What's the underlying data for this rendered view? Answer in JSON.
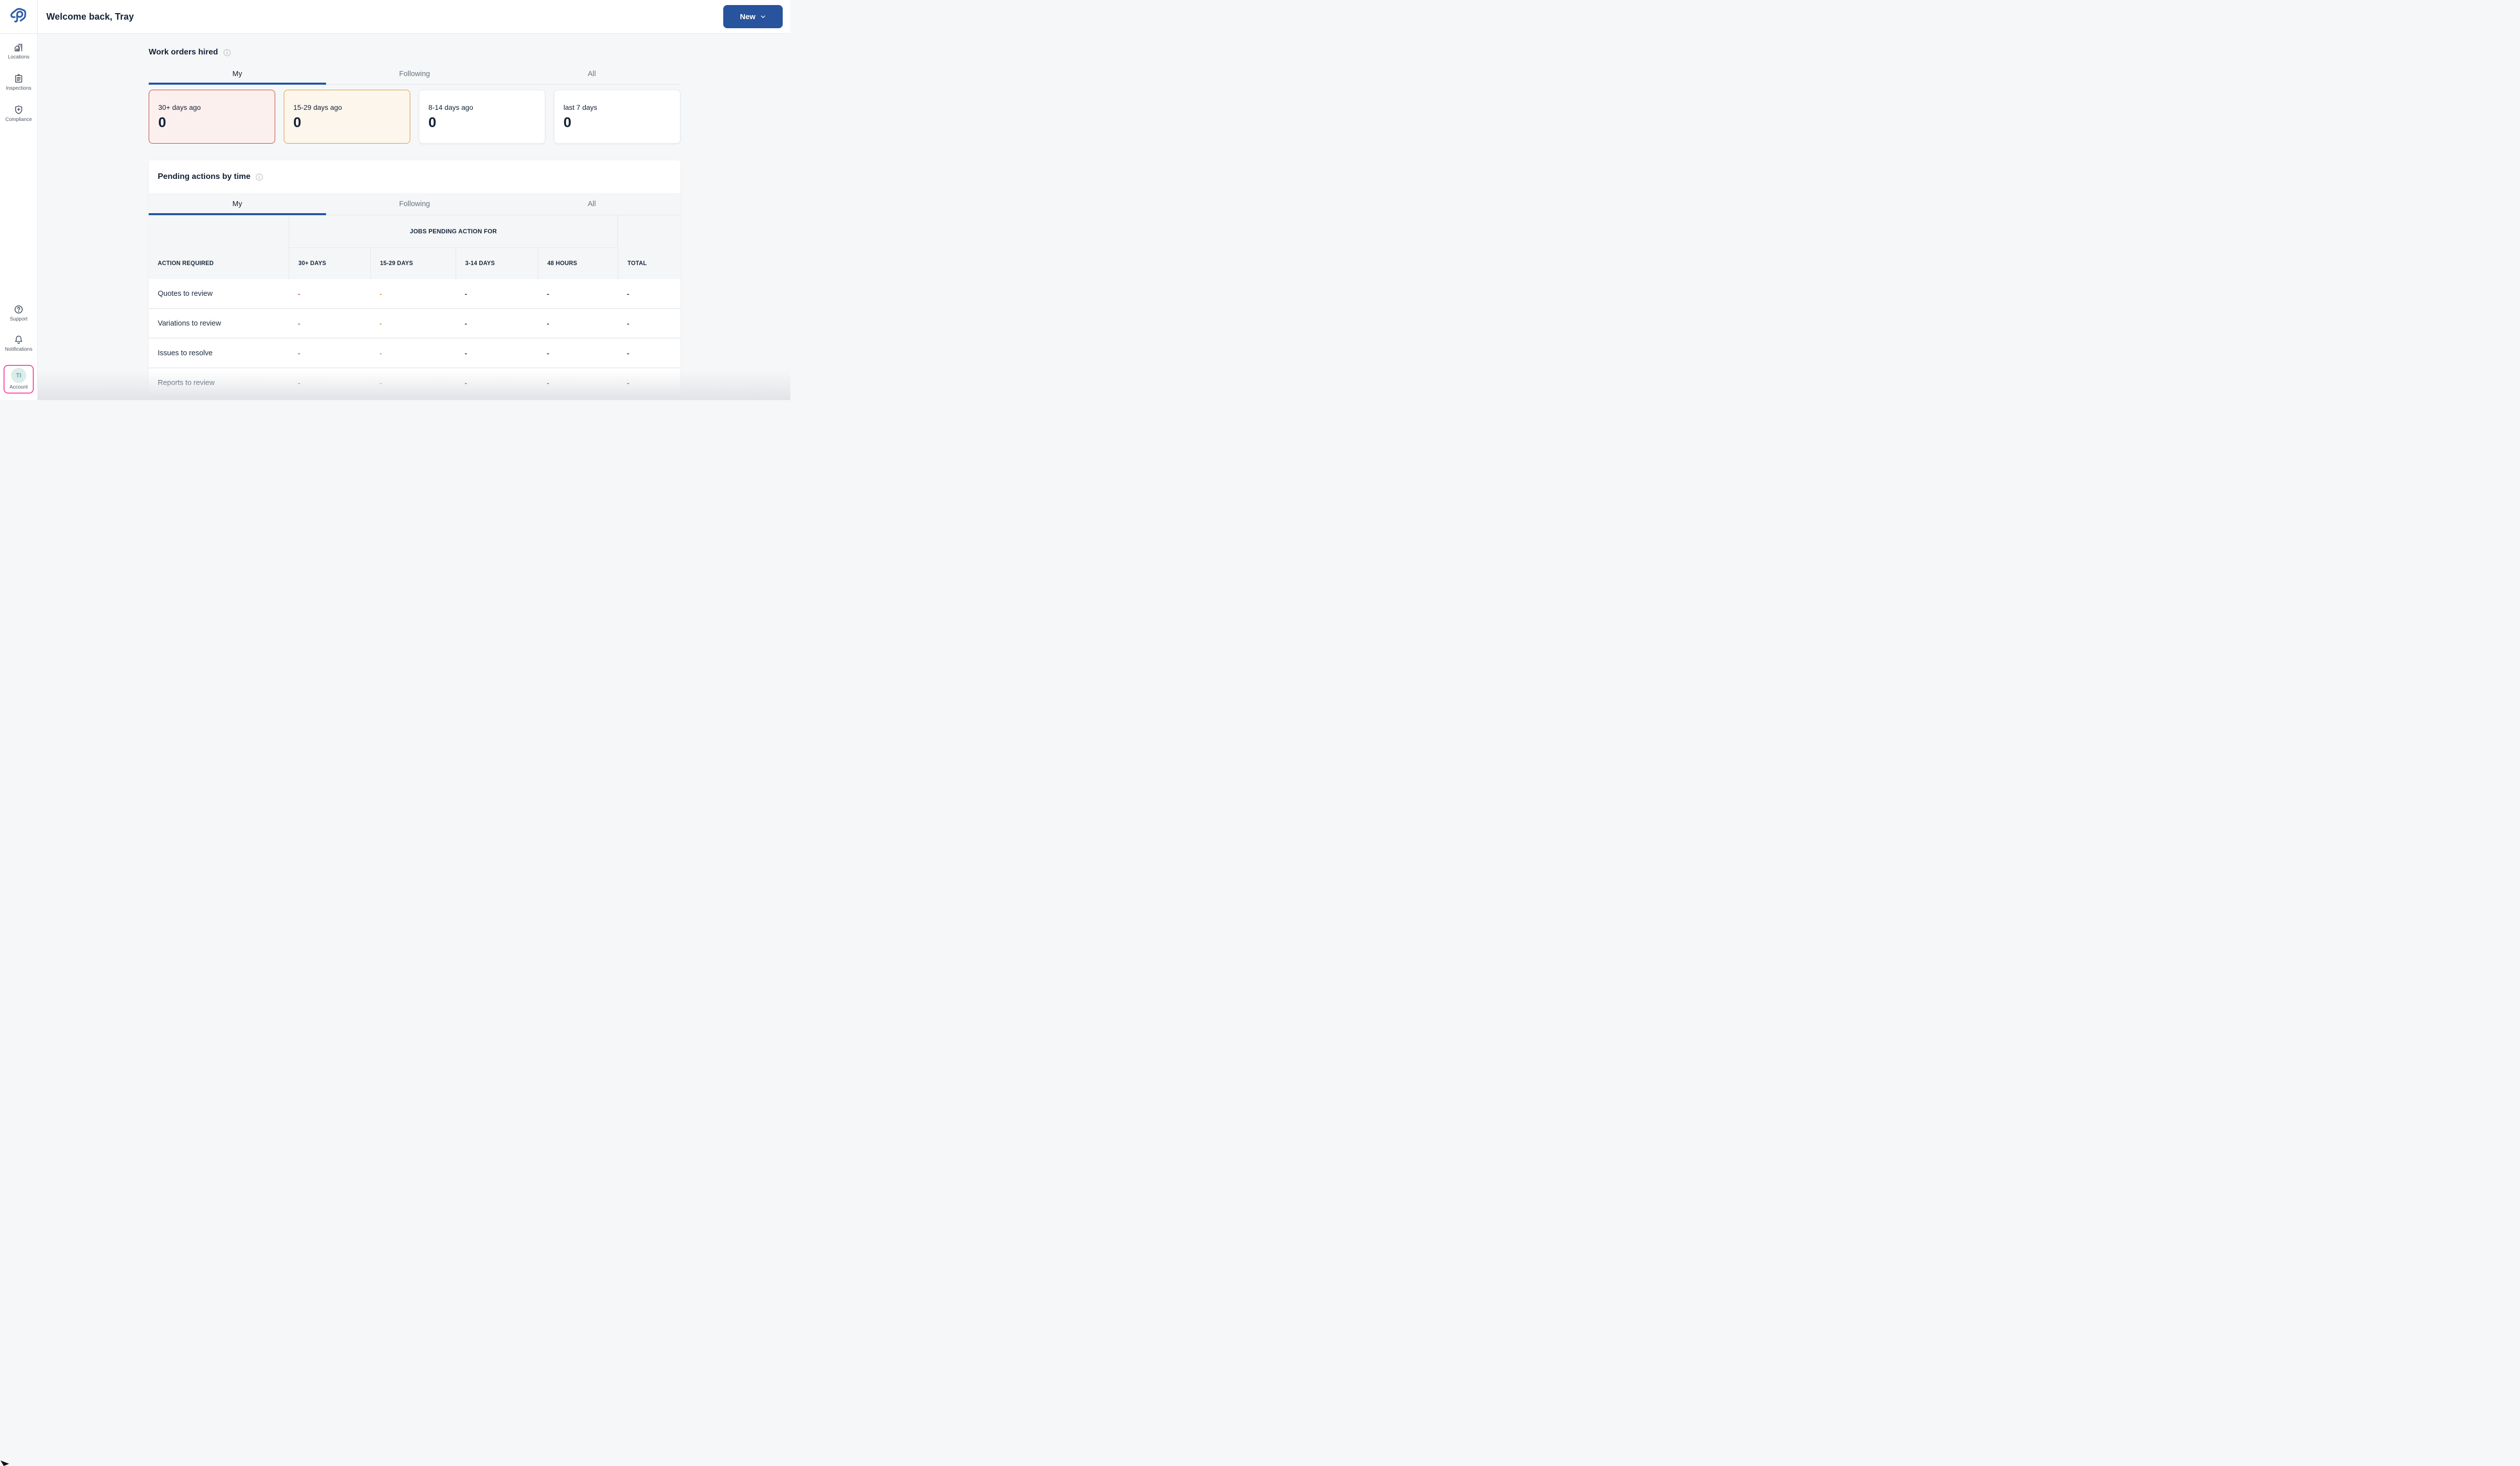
{
  "header": {
    "title": "Welcome back, Tray",
    "new_button": {
      "label": "New"
    }
  },
  "sidebar": {
    "items": [
      {
        "label": "Locations",
        "icon": "building-icon"
      },
      {
        "label": "Inspections",
        "icon": "clipboard-icon"
      },
      {
        "label": "Compliance",
        "icon": "shield-plus-icon"
      }
    ],
    "bottom_items": [
      {
        "label": "Support",
        "icon": "question-circle-icon"
      },
      {
        "label": "Notifications",
        "icon": "bell-icon"
      }
    ],
    "account": {
      "label": "Account",
      "initials": "TI"
    }
  },
  "work_orders": {
    "title": "Work orders hired",
    "tabs": [
      {
        "label": "My",
        "active": true
      },
      {
        "label": "Following",
        "active": false
      },
      {
        "label": "All",
        "active": false
      }
    ],
    "cards": [
      {
        "label": "30+ days ago",
        "value": "0",
        "variant": "danger"
      },
      {
        "label": "15-29 days ago",
        "value": "0",
        "variant": "warning"
      },
      {
        "label": "8-14 days ago",
        "value": "0",
        "variant": "default"
      },
      {
        "label": "last 7 days",
        "value": "0",
        "variant": "default"
      }
    ]
  },
  "pending_actions": {
    "title": "Pending actions by time",
    "tabs": [
      {
        "label": "My",
        "active": true
      },
      {
        "label": "Following",
        "active": false
      },
      {
        "label": "All",
        "active": false
      }
    ],
    "table": {
      "group_header": "JOBS PENDING ACTION FOR",
      "columns": [
        "ACTION REQUIRED",
        "30+ DAYS",
        "15-29 DAYS",
        "3-14 DAYS",
        "48 HOURS",
        "TOTAL"
      ],
      "rows": [
        {
          "label": "Quotes to review",
          "values": [
            "-",
            "-",
            "-",
            "-",
            "-"
          ]
        },
        {
          "label": "Variations to review",
          "values": [
            "-",
            "-",
            "-",
            "-",
            "-"
          ]
        },
        {
          "label": "Issues to resolve",
          "values": [
            "-",
            "-",
            "-",
            "-",
            "-"
          ]
        },
        {
          "label": "Reports to review",
          "values": [
            "-",
            "-",
            "-",
            "-",
            "-"
          ]
        }
      ]
    }
  },
  "colors": {
    "accent_blue": "#27549c",
    "danger_red": "#c1453e",
    "warning_orange": "#d69a3e",
    "account_pink": "#fb4fa5",
    "avatar_teal": "#dcecea"
  }
}
